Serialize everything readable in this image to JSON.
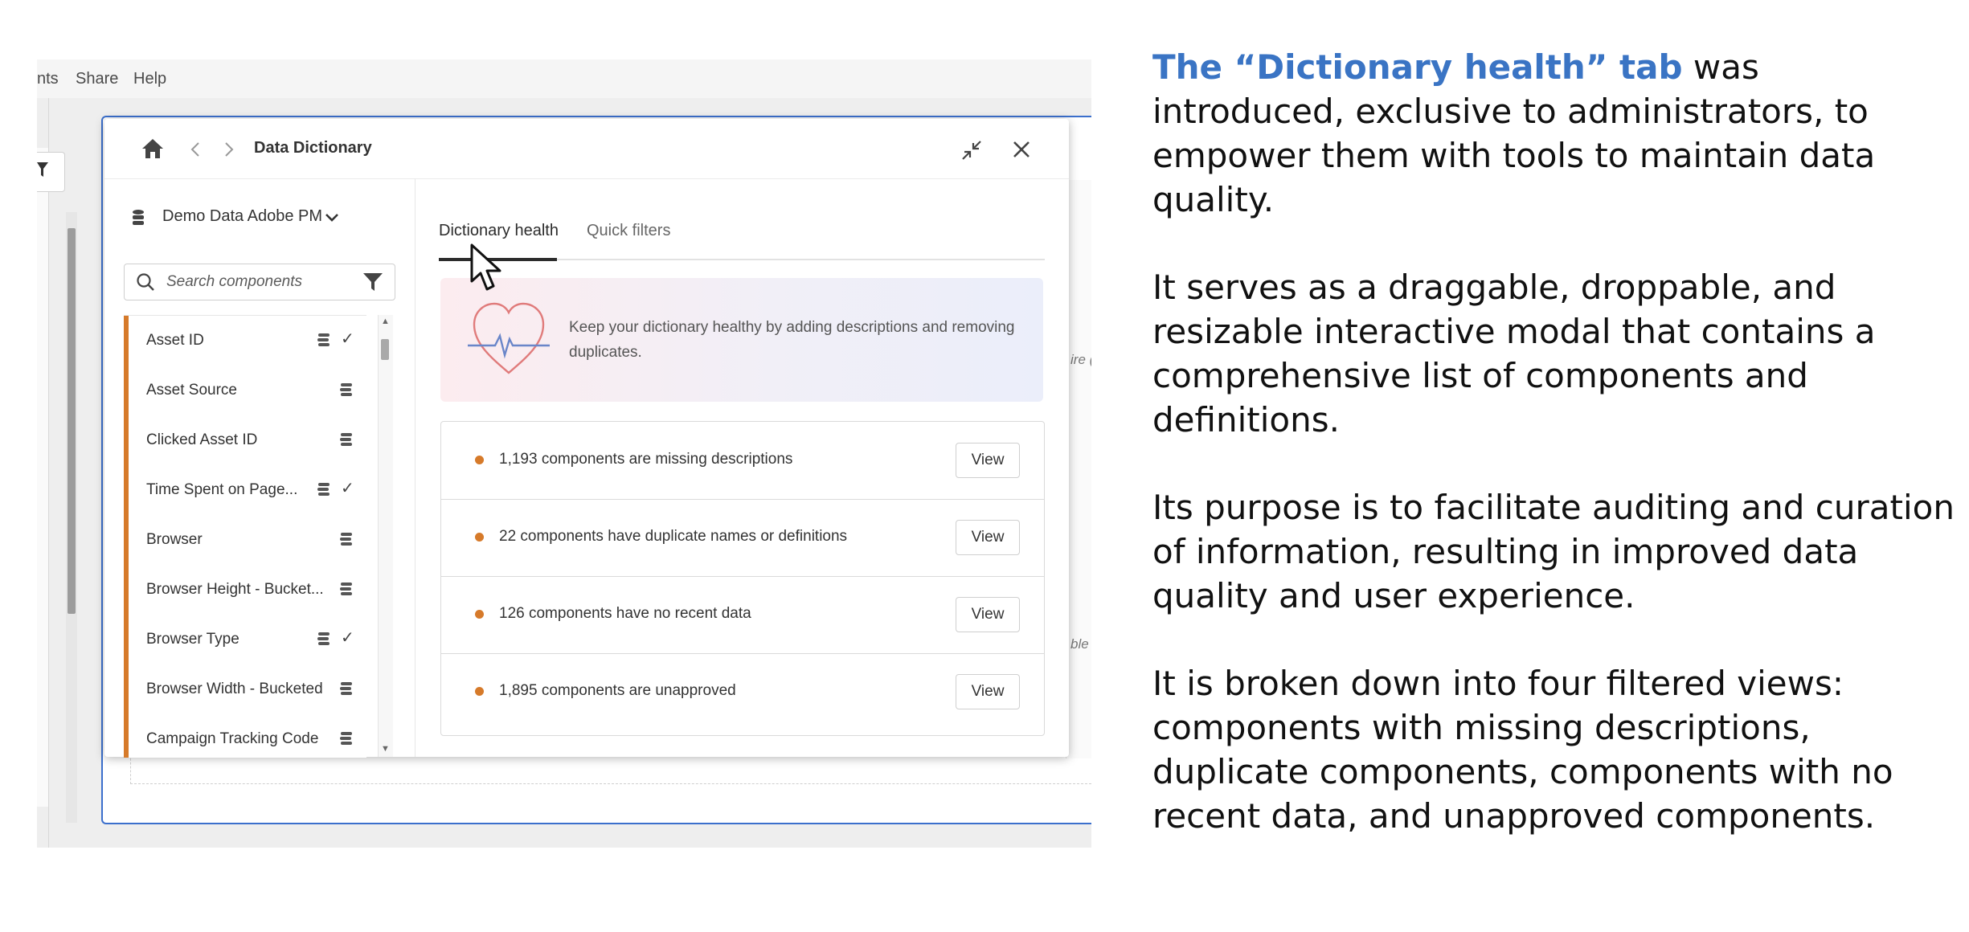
{
  "app_menu": {
    "items": [
      "nts",
      "Share",
      "Help"
    ]
  },
  "background": {
    "right_labels": [
      "ire (",
      "ble"
    ]
  },
  "modal": {
    "title": "Data Dictionary",
    "icons": {
      "home": "home-icon",
      "back": "chevron-left-icon",
      "forward": "chevron-right-icon",
      "minimize": "minimize-icon",
      "close": "close-icon"
    },
    "data_source": {
      "label": "Demo Data Adobe PM",
      "icon": "database-icon",
      "dropdown_icon": "chevron-down-icon"
    },
    "search": {
      "placeholder": "Search components"
    },
    "components": [
      {
        "label": "Asset ID",
        "checked": true
      },
      {
        "label": "Asset Source",
        "checked": false
      },
      {
        "label": "Clicked Asset ID",
        "checked": false
      },
      {
        "label": "Time Spent on Page...",
        "checked": true
      },
      {
        "label": "Browser",
        "checked": false
      },
      {
        "label": "Browser Height - Bucket...",
        "checked": false
      },
      {
        "label": "Browser Type",
        "checked": true
      },
      {
        "label": "Browser Width - Bucketed",
        "checked": false
      },
      {
        "label": "Campaign Tracking Code",
        "checked": false
      }
    ],
    "tabs": [
      {
        "label": "Dictionary health",
        "active": true
      },
      {
        "label": "Quick filters",
        "active": false
      }
    ],
    "banner": {
      "text": "Keep your dictionary healthy by adding descriptions and removing duplicates.",
      "icon": "heart-health-icon"
    },
    "issues": [
      {
        "text": "1,193 components are missing descriptions",
        "button": "View"
      },
      {
        "text": "22 components have duplicate names or definitions",
        "button": "View"
      },
      {
        "text": "126 components have no recent data",
        "button": "View"
      },
      {
        "text": "1,895 components are unapproved",
        "button": "View"
      }
    ]
  },
  "explanation": {
    "p1_highlight": "The “Dictionary health” tab",
    "p1_rest": " was introduced, exclusive to administrators, to empower them with tools to maintain data quality.",
    "p2": "It serves as a draggable, droppable, and resizable interactive modal that contains a comprehensive list of components and definitions.",
    "p3": "Its purpose is to facilitate auditing and curation of information, resulting in improved data quality and user experience.",
    "p4": "It is broken down into four filtered views: components with missing descriptions, duplicate components, components with no recent data, and unapproved components."
  },
  "colors": {
    "accent": "#3a74c4",
    "component_bar": "#d67a2a",
    "canvas_border": "#3b6fcc"
  }
}
